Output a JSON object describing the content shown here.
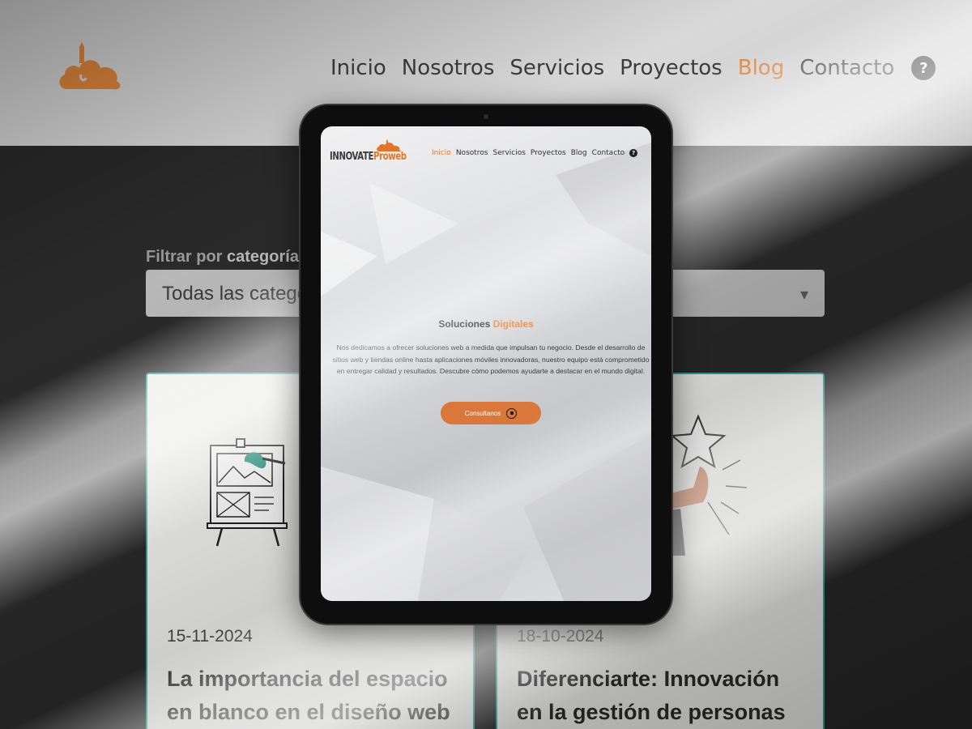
{
  "background_page": {
    "nav": [
      "Inicio",
      "Nosotros",
      "Servicios",
      "Proyectos",
      "Blog",
      "Contacto"
    ],
    "nav_active": "Blog",
    "help_symbol": "?",
    "filter": {
      "label_prefix": "Filtrar por ",
      "label_bold": "categoría",
      "select_value": "Todas las categorías"
    },
    "posts": [
      {
        "date": "15-11-2024",
        "title": "La importancia del espacio en blanco en el diseño web"
      },
      {
        "date": "18-10-2024",
        "title": "Diferenciarte: Innovación en la gestión de personas"
      }
    ],
    "colors": {
      "accent": "#e58a3e",
      "card_border": "#2fa99a",
      "dark_bg": "#2a2a2a"
    }
  },
  "tablet": {
    "logo": {
      "part1": "INNOVATE",
      "part2": "Proweb"
    },
    "nav": [
      "Inicio",
      "Nosotros",
      "Servicios",
      "Proyectos",
      "Blog",
      "Contacto"
    ],
    "nav_active": "Inicio",
    "help_symbol": "?",
    "hero": {
      "title_plain": "Soluciones ",
      "title_accent": "Digitales",
      "body": "Nos dedicamos a ofrecer soluciones web a medida que impulsan tu negocio. Desde el desarrollo de sitios web y tiendas online hasta aplicaciones móviles innovadoras, nuestro equipo está comprometido en entregar calidad y resultados. Descubre cómo podemos ayudarte a destacar en el mundo digital.",
      "cta_label": "Consultanos",
      "cta_icon": "whatsapp-icon"
    },
    "colors": {
      "accent": "#e1762a",
      "cta_bg": "#d9783a"
    }
  }
}
